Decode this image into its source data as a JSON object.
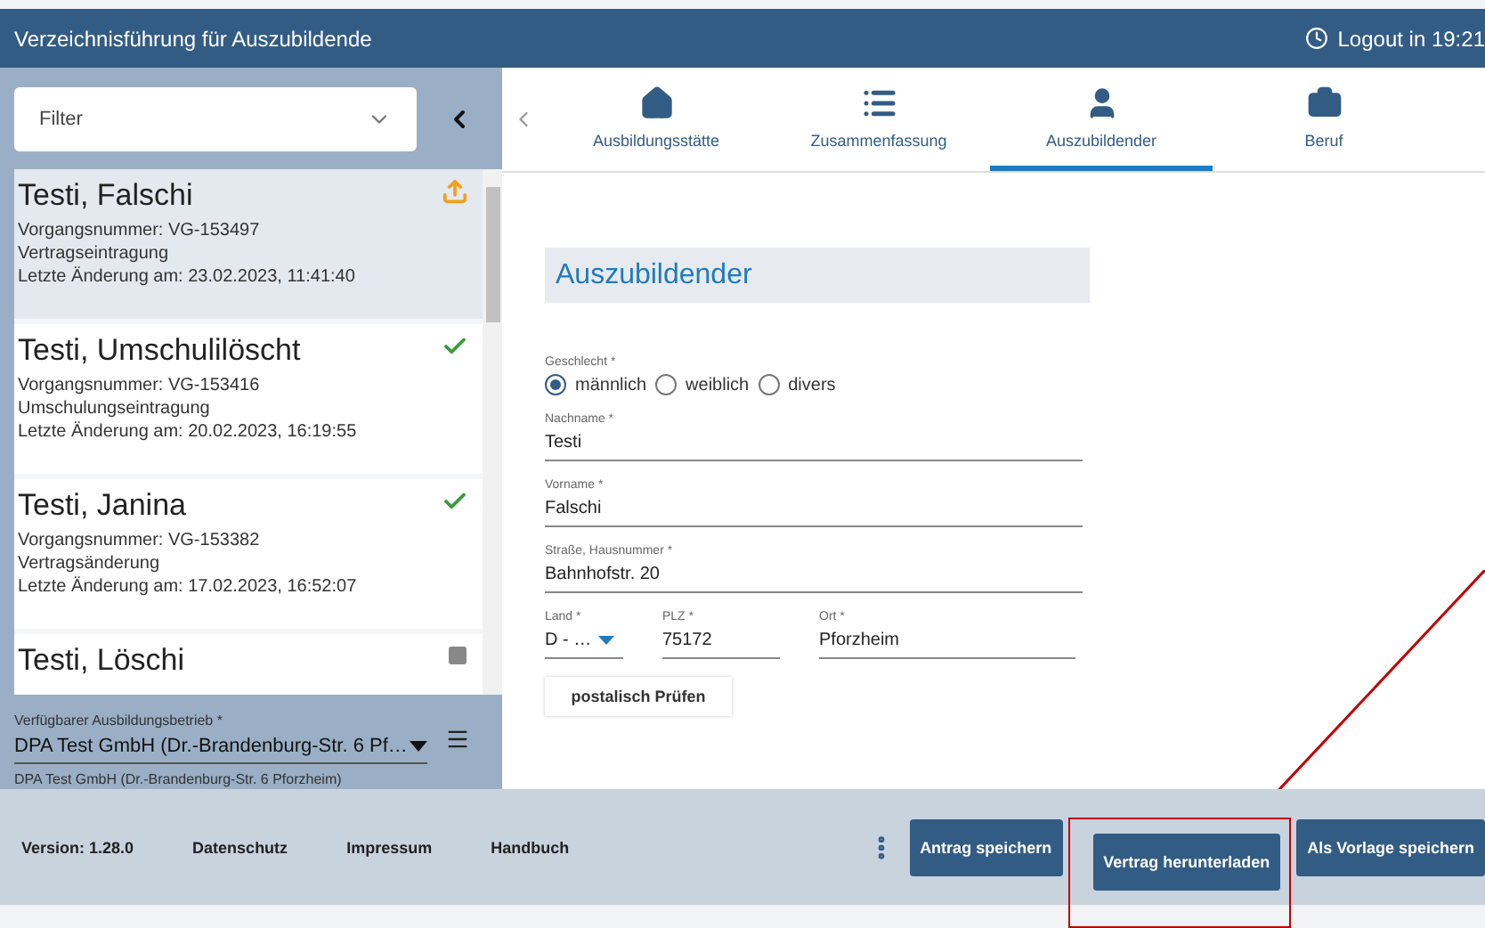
{
  "header": {
    "title": "Verzeichnisführung für Auszubildende",
    "logout": "Logout in 19:21"
  },
  "sidebar": {
    "filter": {
      "placeholder": "Filter"
    },
    "items": [
      {
        "name": "Testi, Falschi",
        "number": "Vorgangsnummer: VG-153497",
        "type": "Vertragseintragung",
        "changed": "Letzte Änderung am: 23.02.2023, 11:41:40",
        "kind": "upload",
        "selected": true
      },
      {
        "name": "Testi, Umschulilöscht",
        "number": "Vorgangsnummer: VG-153416",
        "type": "Umschulungseintragung",
        "changed": "Letzte Änderung am: 20.02.2023, 16:19:55",
        "kind": "done",
        "selected": false
      },
      {
        "name": "Testi, Janina",
        "number": "Vorgangsnummer: VG-153382",
        "type": "Vertragsänderung",
        "changed": "Letzte Änderung am: 17.02.2023, 16:52:07",
        "kind": "done",
        "selected": false
      },
      {
        "name": "Testi, Löschi",
        "kind": "draft",
        "selected": false
      }
    ],
    "company": {
      "label": "Verfügbarer Ausbildungsbetrieb *",
      "value": "DPA Test GmbH (Dr.-Brandenburg-Str. 6 Pf…",
      "hint": "DPA Test GmbH (Dr.-Brandenburg-Str. 6 Pforzheim)"
    }
  },
  "tabs": [
    {
      "label": "Ausbildungsstätte",
      "selected": false
    },
    {
      "label": "Zusammenfassung",
      "selected": false
    },
    {
      "label": "Auszubildender",
      "selected": true
    },
    {
      "label": "Beruf",
      "selected": false
    }
  ],
  "form": {
    "title": "Auszubildender",
    "gender": {
      "label": "Geschlecht *",
      "options": [
        {
          "label": "männlich",
          "selected": true
        },
        {
          "label": "weiblich",
          "selected": false
        },
        {
          "label": "divers",
          "selected": false
        }
      ]
    },
    "fields": [
      {
        "label": "Nachname *",
        "value": "Testi"
      },
      {
        "label": "Vorname *",
        "value": "Falschi"
      },
      {
        "label": "Straße, Hausnummer *",
        "value": "Bahnhofstr. 20"
      }
    ],
    "address": [
      {
        "label": "Land *",
        "value": "D - …",
        "kind": "select"
      },
      {
        "label": "PLZ *",
        "value": "75172",
        "kind": "text"
      },
      {
        "label": "Ort *",
        "value": "Pforzheim",
        "kind": "text"
      }
    ],
    "check_button": "postalisch Prüfen"
  },
  "footer": {
    "links": [
      "Version: 1.28.0",
      "Datenschutz",
      "Impressum",
      "Handbuch"
    ],
    "buttons": [
      {
        "label": "Antrag speichern",
        "highlighted": false
      },
      {
        "label": "Vertrag herunterladen",
        "highlighted": true
      },
      {
        "label": "Als Vorlage speichern",
        "highlighted": false
      }
    ]
  }
}
